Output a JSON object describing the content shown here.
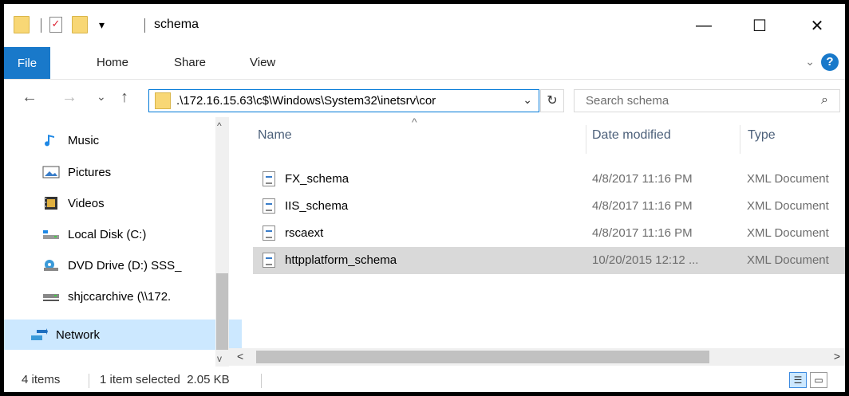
{
  "window": {
    "title": "schema",
    "minimize_glyph": "—",
    "maximize_glyph": "☐",
    "close_glyph": "✕",
    "qat_dropdown_glyph": "▾"
  },
  "ribbon": {
    "file_label": "File",
    "tabs": [
      "Home",
      "Share",
      "View"
    ],
    "help_glyph": "?",
    "collapse_glyph": "⌄"
  },
  "address": {
    "back_glyph": "←",
    "forward_glyph": "→",
    "recent_glyph": "⌄",
    "up_glyph": "↑",
    "path": ".\\172.16.15.63\\c$\\Windows\\System32\\inetsrv\\cor",
    "dropdown_glyph": "⌄",
    "refresh_glyph": "↻",
    "search_placeholder": "Search schema",
    "search_glyph": "⌕"
  },
  "nav": {
    "items": [
      {
        "label": "Music",
        "icon": "music-icon"
      },
      {
        "label": "Pictures",
        "icon": "pictures-icon"
      },
      {
        "label": "Videos",
        "icon": "videos-icon"
      },
      {
        "label": "Local Disk (C:)",
        "icon": "drive-icon"
      },
      {
        "label": "DVD Drive (D:) SSS_",
        "icon": "dvd-icon"
      },
      {
        "label": "shjccarchive (\\\\172.",
        "icon": "network-drive-icon"
      },
      {
        "label": "Network",
        "icon": "network-icon"
      }
    ],
    "scroll_up_glyph": "^",
    "scroll_down_glyph": "v"
  },
  "list": {
    "columns": [
      "Name",
      "Date modified",
      "Type"
    ],
    "sort_glyph": "^",
    "rows": [
      {
        "name": "FX_schema",
        "date": "4/8/2017 11:16 PM",
        "type": "XML Document"
      },
      {
        "name": "IIS_schema",
        "date": "4/8/2017 11:16 PM",
        "type": "XML Document"
      },
      {
        "name": "rscaext",
        "date": "4/8/2017 11:16 PM",
        "type": "XML Document"
      },
      {
        "name": "httpplatform_schema",
        "date": "10/20/2015 12:12 ...",
        "type": "XML Document"
      }
    ],
    "scroll_left_glyph": "<",
    "scroll_right_glyph": ">"
  },
  "status": {
    "item_count": "4 items",
    "selection": "1 item selected  2.05 KB"
  },
  "colors": {
    "accent": "#1979ca",
    "selection": "#d9d9d9",
    "nav_selection": "#cce8ff"
  }
}
